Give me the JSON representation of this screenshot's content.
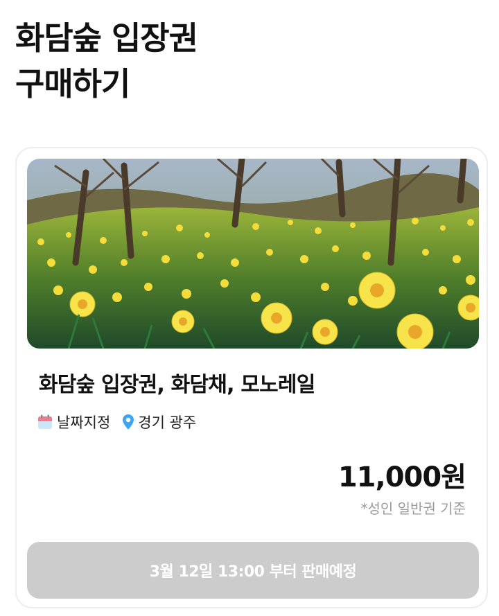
{
  "header": {
    "title_line1": "화담숲 입장권",
    "title_line2": "구매하기"
  },
  "product": {
    "image_icon": "daffodil-field-photo",
    "title": "화담숲 입장권, 화담채, 모노레일",
    "date_icon": "calendar-icon",
    "date_label": "날짜지정",
    "location_icon": "location-pin-icon",
    "location_label": "경기 광주",
    "price": "11,000원",
    "price_note": "*성인 일반권 기준",
    "button_label": "3월 12일 13:00 부터 판매예정"
  },
  "colors": {
    "button_disabled": "#cccccc",
    "calendar_accent": "#f07a8e",
    "pin_accent": "#3da5f4",
    "muted_text": "#9a9a9a"
  }
}
